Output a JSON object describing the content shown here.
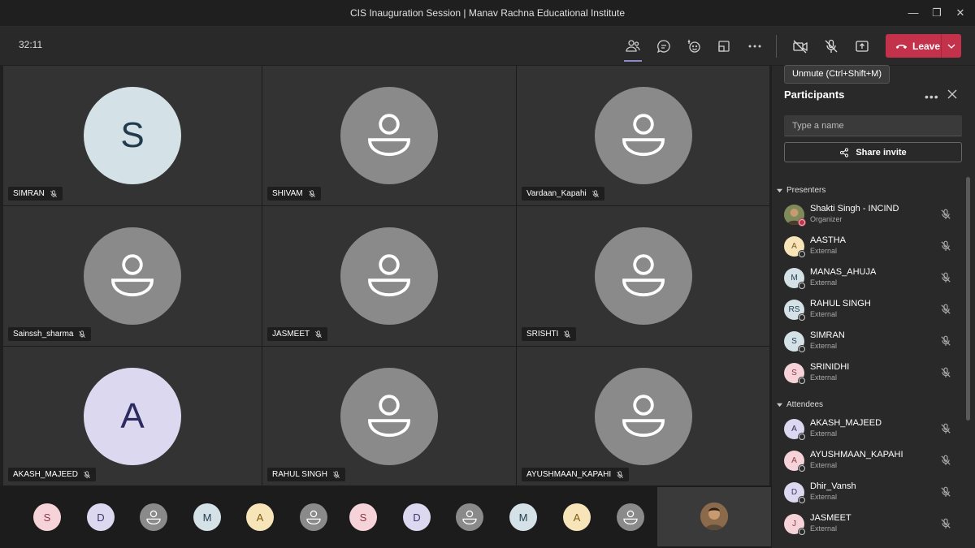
{
  "window": {
    "title": "CIS Inauguration Session | Manav Rachna Educational Institute"
  },
  "toolbar": {
    "timer": "32:11",
    "leave_label": "Leave",
    "tooltip": "Unmute (Ctrl+Shift+M)"
  },
  "grid": {
    "tiles": [
      {
        "name": "SIMRAN",
        "initial": "S",
        "bg": "#d4e1e6",
        "fg": "#1f3b4d"
      },
      {
        "name": "SHIVAM",
        "initial": "",
        "bg": "#8a8a8a",
        "fg": ""
      },
      {
        "name": "Vardaan_Kapahi",
        "initial": "",
        "bg": "#8a8a8a",
        "fg": ""
      },
      {
        "name": "Sainssh_sharma",
        "initial": "",
        "bg": "#8a8a8a",
        "fg": ""
      },
      {
        "name": "JASMEET",
        "initial": "",
        "bg": "#8a8a8a",
        "fg": ""
      },
      {
        "name": "SRISHTI",
        "initial": "",
        "bg": "#8a8a8a",
        "fg": ""
      },
      {
        "name": "AKASH_MAJEED",
        "initial": "A",
        "bg": "#dcd8ef",
        "fg": "#2c2a5e"
      },
      {
        "name": "RAHUL SINGH",
        "initial": "",
        "bg": "#8a8a8a",
        "fg": ""
      },
      {
        "name": "AYUSHMAAN_KAPAHI",
        "initial": "",
        "bg": "#8a8a8a",
        "fg": ""
      }
    ]
  },
  "strip": {
    "avatars": [
      {
        "initial": "S",
        "bg": "#f5d3d8",
        "fg": "#8a3844"
      },
      {
        "initial": "D",
        "bg": "#dcd8ef",
        "fg": "#3c3a6e"
      },
      {
        "initial": "",
        "bg": "#8a8a8a",
        "fg": ""
      },
      {
        "initial": "M",
        "bg": "#d4e1e6",
        "fg": "#1f3b4d"
      },
      {
        "initial": "A",
        "bg": "#f7e4b8",
        "fg": "#7a5a14"
      },
      {
        "initial": "",
        "bg": "#8a8a8a",
        "fg": ""
      },
      {
        "initial": "S",
        "bg": "#f5d3d8",
        "fg": "#8a3844"
      },
      {
        "initial": "D",
        "bg": "#dcd8ef",
        "fg": "#3c3a6e"
      },
      {
        "initial": "",
        "bg": "#8a8a8a",
        "fg": ""
      },
      {
        "initial": "M",
        "bg": "#d4e1e6",
        "fg": "#1f3b4d"
      },
      {
        "initial": "A",
        "bg": "#f7e4b8",
        "fg": "#7a5a14"
      },
      {
        "initial": "",
        "bg": "#8a8a8a",
        "fg": ""
      }
    ]
  },
  "panel": {
    "title": "Participants",
    "search_placeholder": "Type a name",
    "share_label": "Share invite",
    "presenters_label": "Presenters",
    "attendees_label": "Attendees",
    "presenters": [
      {
        "name": "Shakti Singh - INCIND",
        "role": "Organizer",
        "initial": "",
        "bg": "#a87c5a",
        "fg": "#fff"
      },
      {
        "name": "AASTHA",
        "role": "External",
        "initial": "A",
        "bg": "#f7e4b8",
        "fg": "#7a5a14"
      },
      {
        "name": "MANAS_AHUJA",
        "role": "External",
        "initial": "M",
        "bg": "#d4e1e6",
        "fg": "#1f3b4d"
      },
      {
        "name": "RAHUL SINGH",
        "role": "External",
        "initial": "RS",
        "bg": "#d4e1e6",
        "fg": "#1f3b4d"
      },
      {
        "name": "SIMRAN",
        "role": "External",
        "initial": "S",
        "bg": "#d4e1e6",
        "fg": "#1f3b4d"
      },
      {
        "name": "SRINIDHI",
        "role": "External",
        "initial": "S",
        "bg": "#f5d3d8",
        "fg": "#8a3844"
      }
    ],
    "attendees": [
      {
        "name": "AKASH_MAJEED",
        "role": "External",
        "initial": "A",
        "bg": "#dcd8ef",
        "fg": "#2c2a5e"
      },
      {
        "name": "AYUSHMAAN_KAPAHI",
        "role": "External",
        "initial": "A",
        "bg": "#f5d3d8",
        "fg": "#8a3844"
      },
      {
        "name": "Dhir_Vansh",
        "role": "External",
        "initial": "D",
        "bg": "#dcd8ef",
        "fg": "#3c3a6e"
      },
      {
        "name": "JASMEET",
        "role": "External",
        "initial": "J",
        "bg": "#f5d3d8",
        "fg": "#8a3844"
      }
    ]
  }
}
